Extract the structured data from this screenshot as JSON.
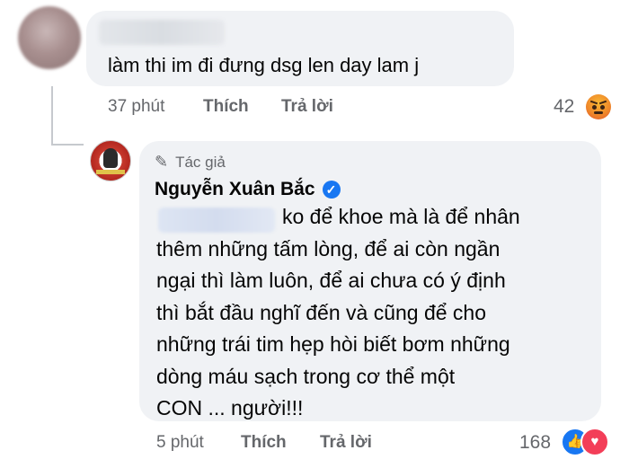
{
  "comment1": {
    "text": "làm thi im đi đưng dsg len day lam j",
    "time": "37 phút",
    "like_label": "Thích",
    "reply_label": "Trả lời",
    "reaction_count": "42",
    "reaction_icon": "angry-emoji-icon"
  },
  "reply": {
    "author_badge": "Tác giả",
    "author_name": "Nguyễn Xuân Bắc",
    "text": "ko để khoe mà là để  nhân\nthêm những tấm lòng, để ai còn ngần\nngại thì làm luôn, để ai chưa có ý định\nthì bắt đầu nghĩ đến và cũng để cho\nnhững  trái tim hẹp hòi biết bơm những\ndòng máu sạch trong cơ thể một\nCON ... người!!!",
    "time": "5 phút",
    "like_label": "Thích",
    "reply_label": "Trả lời",
    "reaction_count": "168",
    "reaction_icons": [
      "like-icon",
      "love-icon"
    ]
  },
  "colors": {
    "bubble": "#f0f2f5",
    "meta": "#65676b",
    "verified": "#1877f2",
    "love": "#f33e58"
  }
}
